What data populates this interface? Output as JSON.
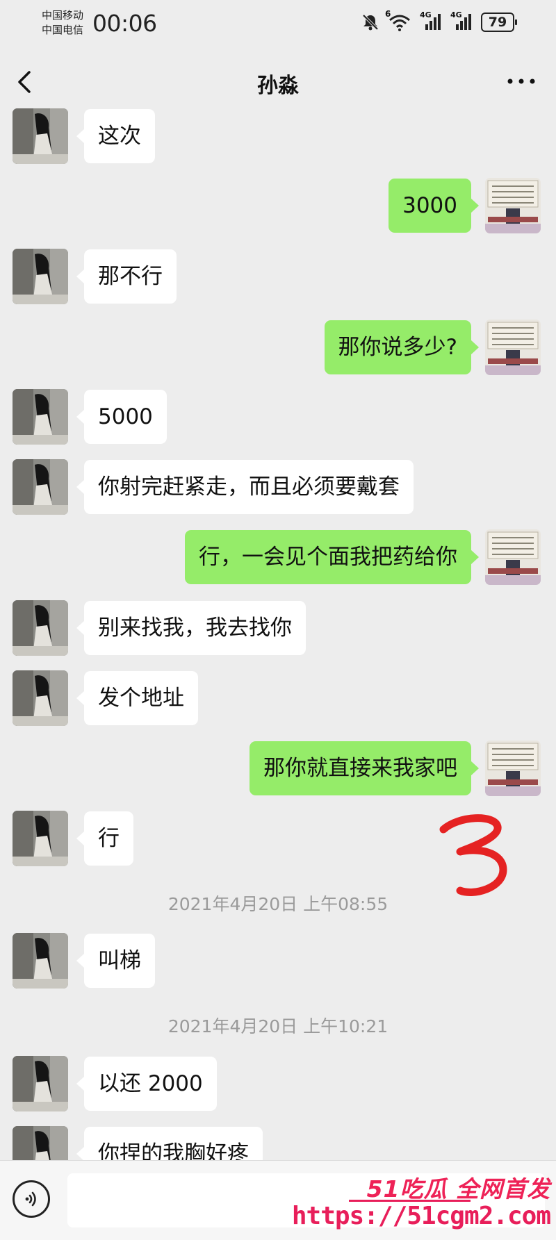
{
  "status_bar": {
    "carrier_1": "中国移动",
    "carrier_2": "中国电信",
    "time": "00:06",
    "icons": [
      "mute-icon",
      "wifi-icon",
      "signal-4g-icon",
      "signal-4g-icon"
    ],
    "wifi_label": "6",
    "net_label_1": "4G",
    "net_label_2": "4G",
    "battery": "79"
  },
  "header": {
    "title": "孙淼",
    "back_icon": "chevron-left-icon",
    "more_icon": "more-dots-icon"
  },
  "messages": [
    {
      "side": "left",
      "text": "这次"
    },
    {
      "side": "right",
      "text": "3000"
    },
    {
      "side": "left",
      "text": "那不行"
    },
    {
      "side": "right",
      "text": "那你说多少?"
    },
    {
      "side": "left",
      "text": "5000"
    },
    {
      "side": "left",
      "text": "你射完赶紧走，而且必须要戴套"
    },
    {
      "side": "right",
      "text": "行，一会见个面我把药给你"
    },
    {
      "side": "left",
      "text": "别来找我，我去找你"
    },
    {
      "side": "left",
      "text": "发个地址"
    },
    {
      "side": "right",
      "text": "那你就直接来我家吧"
    },
    {
      "side": "left",
      "text": "行"
    },
    {
      "type": "time",
      "text": "2021年4月20日 上午08:55"
    },
    {
      "side": "left",
      "text": "叫梯"
    },
    {
      "type": "time",
      "text": "2021年4月20日 上午10:21"
    },
    {
      "side": "left",
      "text": "以还 2000"
    },
    {
      "side": "left",
      "text": "你捏的我胸好疼"
    }
  ],
  "input_bar": {
    "voice_icon": "voice-icon",
    "placeholder": ""
  },
  "watermark": {
    "line1": "51吃瓜 全网首发",
    "line2": "https://51cgm2.com"
  },
  "colors": {
    "background": "#ededed",
    "bubble_self": "#95ec69",
    "bubble_other": "#ffffff",
    "watermark": "#e81e5a",
    "scribble": "#e52222"
  }
}
